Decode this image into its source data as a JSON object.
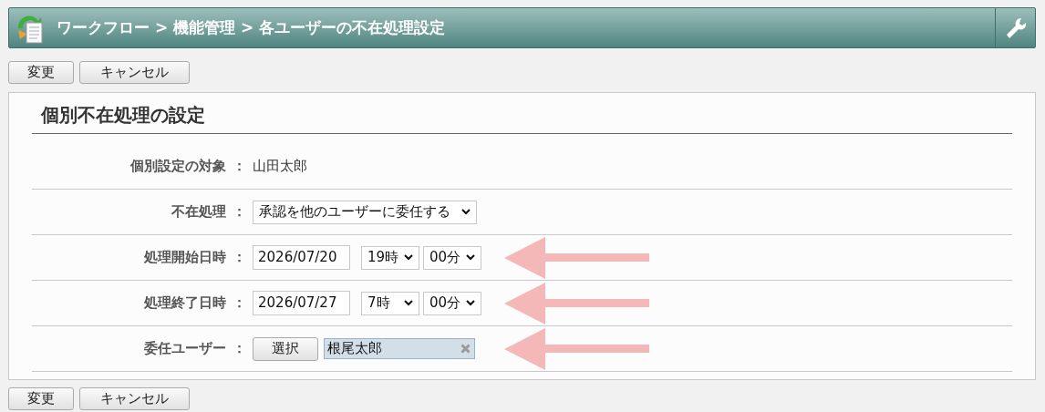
{
  "header": {
    "breadcrumb": "ワークフロー > 機能管理 > 各ユーザーの不在処理設定"
  },
  "top_buttons": [
    "変更",
    "キャンセル"
  ],
  "section_title": "個別不在処理の設定",
  "rows": [
    {
      "kind": "text",
      "label": "個別設定の対象",
      "colon": "：",
      "value": "山田太郎",
      "arrow": false
    },
    {
      "kind": "select",
      "label": "不在処理",
      "colon": "：",
      "value": "承認を他のユーザーに委任する",
      "arrow": false
    },
    {
      "kind": "datetime",
      "label": "処理開始日時",
      "colon": "：",
      "date": "2026/07/20",
      "hour": "19時",
      "minute": "00分",
      "arrow": true
    },
    {
      "kind": "datetime",
      "label": "処理終了日時",
      "colon": "：",
      "date": "2026/07/27",
      "hour": "7時",
      "minute": "00分",
      "arrow": true
    },
    {
      "kind": "user",
      "label": "委任ユーザー",
      "colon": "：",
      "button": "選択",
      "value": "根尾太郎",
      "arrow": true
    }
  ],
  "bottom_buttons": [
    "変更",
    "キャンセル"
  ]
}
